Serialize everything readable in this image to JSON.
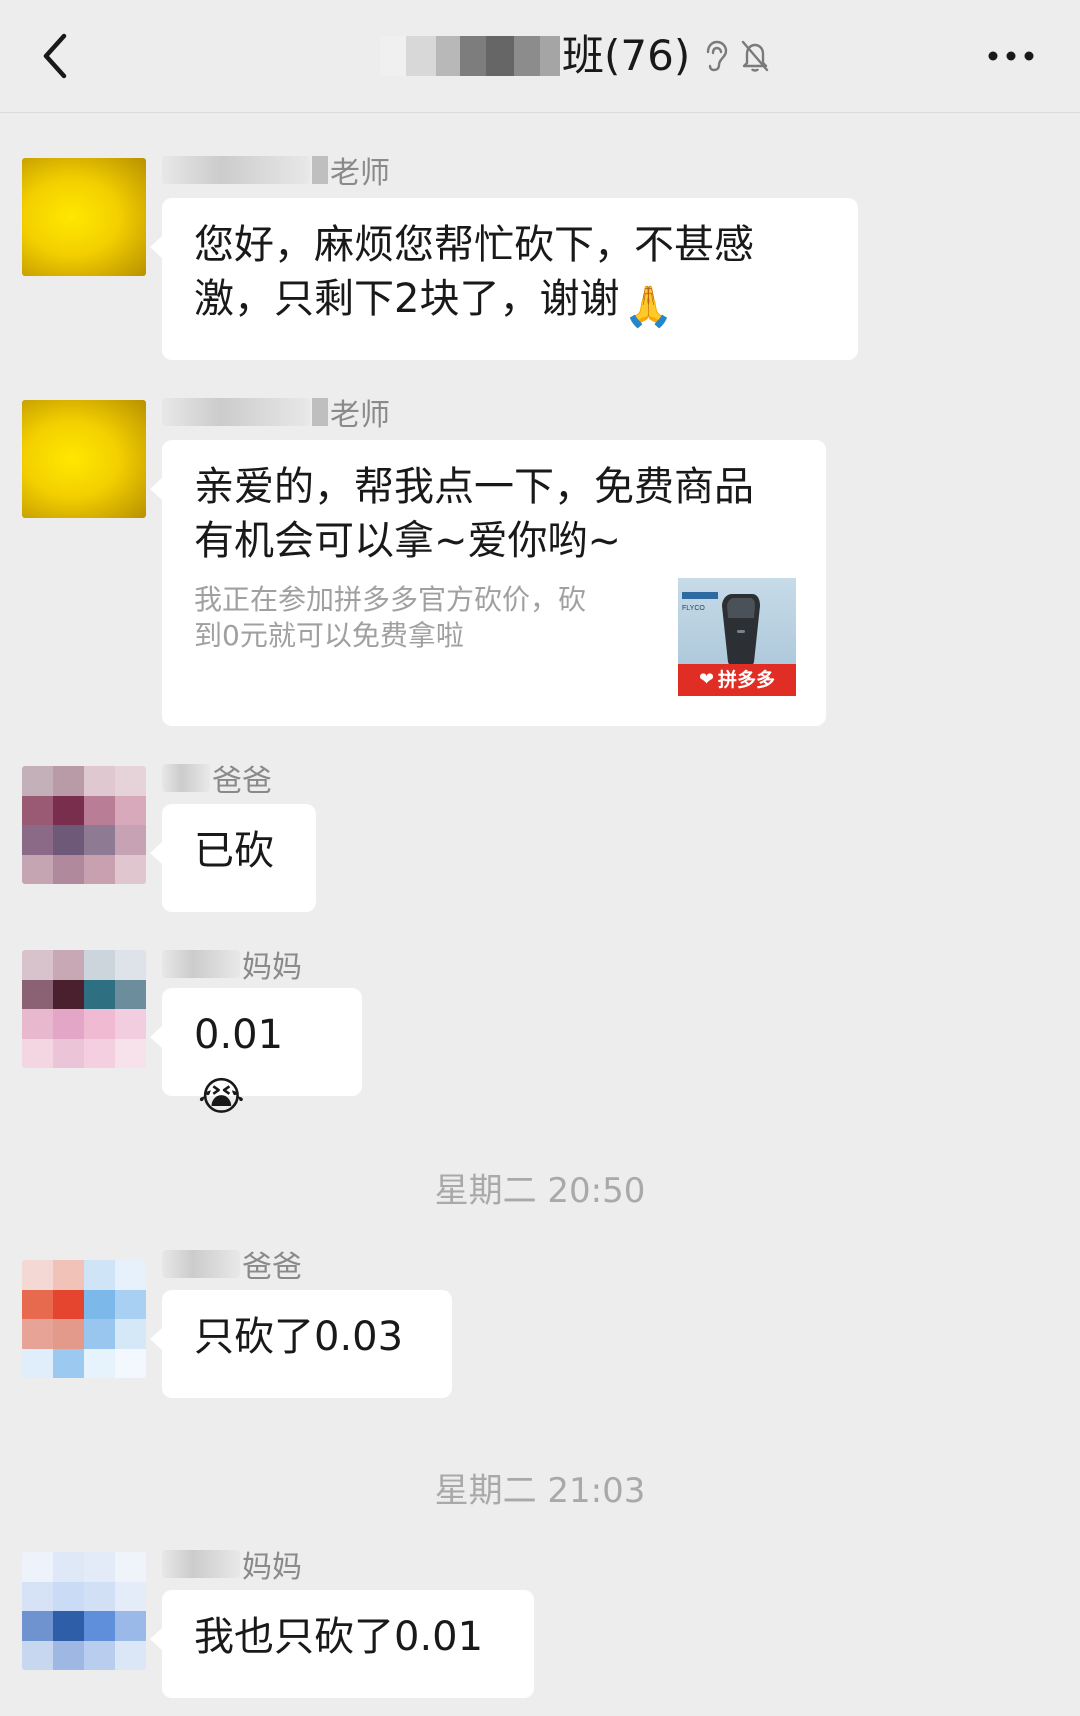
{
  "header": {
    "title": "班(76)",
    "back_icon": "chevron-left-icon",
    "ear_icon": "earpiece-icon",
    "mute_icon": "bell-off-icon",
    "more_icon": "more-horizontal-icon"
  },
  "messages": [
    {
      "sender": "老师",
      "text_line1": "您好，麻烦您帮忙砍下，不甚感",
      "text_line2": "激，只剩下2块了，谢谢",
      "emoji": "🙏"
    },
    {
      "sender": "老师",
      "text_line1": "亲爱的，帮我点一下，免费商品",
      "text_line2": "有机会可以拿~爱你哟~",
      "card_desc_line1": "我正在参加拼多多官方砍价，砍",
      "card_desc_line2": "到0元就可以免费拿啦",
      "card_brand": "FLYCO",
      "card_logo": "拼多多"
    },
    {
      "sender": "爸爸",
      "text": "已砍"
    },
    {
      "sender": "妈妈",
      "text": "0.01",
      "emoji": "😭"
    },
    {
      "sender": "爸爸",
      "text": "只砍了0.03"
    },
    {
      "sender": "妈妈",
      "text": "我也只砍了0.01"
    }
  ],
  "timestamps": [
    "星期二 20:50",
    "星期二 21:03"
  ],
  "colors": {
    "background": "#ededed",
    "bubble": "#ffffff",
    "pdd_red": "#e02e24"
  }
}
